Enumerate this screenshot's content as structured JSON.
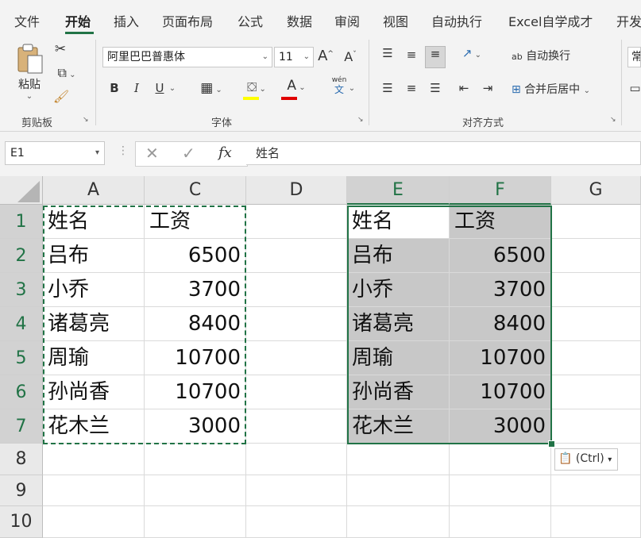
{
  "tabs": [
    "文件",
    "开始",
    "插入",
    "页面布局",
    "公式",
    "数据",
    "审阅",
    "视图",
    "自动执行",
    "Excel自学成才",
    "开发"
  ],
  "ribbon": {
    "clipboard": {
      "paste_label": "粘贴",
      "group_label": "剪贴板"
    },
    "font": {
      "name": "阿里巴巴普惠体",
      "size": "11",
      "grow": "A",
      "shrink": "A",
      "bold": "B",
      "italic": "I",
      "underline": "U",
      "font_color_glyph": "A",
      "wen": "wén",
      "wen2": "文",
      "group_label": "字体"
    },
    "align": {
      "wrap_text": "自动换行",
      "merge_center": "合并后居中",
      "ab": "ab",
      "group_label": "对齐方式"
    },
    "number": {
      "format_partial": "常"
    }
  },
  "formula_bar": {
    "name_box": "E1",
    "formula": "姓名",
    "fx": "fx"
  },
  "grid": {
    "columns": [
      "A",
      "C",
      "D",
      "E",
      "F",
      "G"
    ],
    "rows": [
      "1",
      "2",
      "3",
      "4",
      "5",
      "6",
      "7",
      "8",
      "9",
      "10"
    ],
    "source": [
      [
        "姓名",
        "工资"
      ],
      [
        "吕布",
        "6500"
      ],
      [
        "小乔",
        "3700"
      ],
      [
        "诸葛亮",
        "8400"
      ],
      [
        "周瑜",
        "10700"
      ],
      [
        "孙尚香",
        "10700"
      ],
      [
        "花木兰",
        "3000"
      ]
    ],
    "pasted": [
      [
        "姓名",
        "工资"
      ],
      [
        "吕布",
        "6500"
      ],
      [
        "小乔",
        "3700"
      ],
      [
        "诸葛亮",
        "8400"
      ],
      [
        "周瑜",
        "10700"
      ],
      [
        "孙尚香",
        "10700"
      ],
      [
        "花木兰",
        "3000"
      ]
    ]
  },
  "paste_options": {
    "label": "(Ctrl)"
  },
  "colors": {
    "accent": "#217346",
    "selection_fill": "#c8c8c8"
  }
}
